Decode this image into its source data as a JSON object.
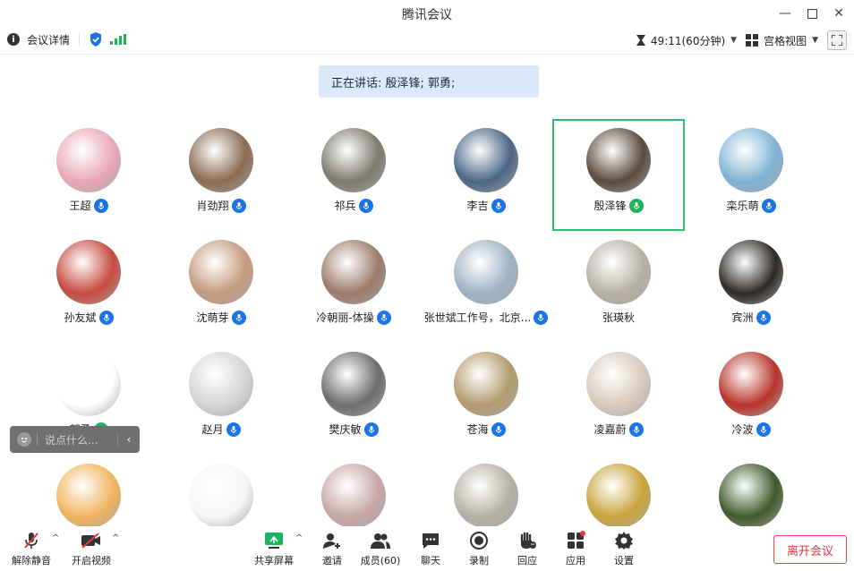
{
  "window": {
    "title": "腾讯会议",
    "controls": [
      "minimize-icon",
      "maximize-icon",
      "close-icon"
    ]
  },
  "infobar": {
    "details_label": "会议详情",
    "timer": "49:11(60分钟)",
    "view_label": "宫格视图"
  },
  "speaking_banner": "正在讲话: 殷泽锋; 郭勇;",
  "participants": [
    {
      "name": "王超",
      "mic": "blue",
      "color": "#e9a8b8"
    },
    {
      "name": "肖劲翔",
      "mic": "blue",
      "color": "#8a6b52"
    },
    {
      "name": "祁兵",
      "mic": "blue",
      "color": "#7d7a6e"
    },
    {
      "name": "李吉",
      "mic": "blue",
      "color": "#4a6684"
    },
    {
      "name": "殷泽锋",
      "mic": "green",
      "color": "#5b4a3f"
    },
    {
      "name": "栾乐萌",
      "mic": "blue",
      "color": "#7fb3d6"
    },
    {
      "name": "孙友斌",
      "mic": "blue",
      "color": "#c64a3f"
    },
    {
      "name": "沈萌芽",
      "mic": "blue",
      "color": "#c59a7e"
    },
    {
      "name": "冷朝丽-体操",
      "mic": "blue",
      "color": "#9c7b6a"
    },
    {
      "name": "张世斌工作号，北京...",
      "mic": "blue",
      "color": "#9fb2c5"
    },
    {
      "name": "张瑛秋",
      "mic": "none",
      "color": "#b7b0a6"
    },
    {
      "name": "宾洲",
      "mic": "blue",
      "color": "#2e2a26"
    },
    {
      "name": "郭勇",
      "mic": "green",
      "color": "#ffffff"
    },
    {
      "name": "赵月",
      "mic": "blue",
      "color": "#d5d5d5"
    },
    {
      "name": "樊庆敏",
      "mic": "blue",
      "color": "#6d6d6d"
    },
    {
      "name": "苍海",
      "mic": "blue",
      "color": "#b39a6e"
    },
    {
      "name": "凌嘉蔚",
      "mic": "blue",
      "color": "#d8c9bd"
    },
    {
      "name": "冷波",
      "mic": "blue",
      "color": "#b8352d"
    },
    {
      "name": "",
      "mic": "none",
      "color": "#f1b45e"
    },
    {
      "name": "",
      "mic": "none",
      "color": "#f5f5f5"
    },
    {
      "name": "",
      "mic": "none",
      "color": "#c8a7a8"
    },
    {
      "name": "",
      "mic": "none",
      "color": "#b6b0a4"
    },
    {
      "name": "",
      "mic": "none",
      "color": "#c9a43c"
    },
    {
      "name": "",
      "mic": "none",
      "color": "#3f5a2b"
    }
  ],
  "chat": {
    "placeholder": "说点什么..."
  },
  "toolbar": {
    "unmute": "解除静音",
    "start_video": "开启视频",
    "share_screen": "共享屏幕",
    "invite": "邀请",
    "members": "成员(60)",
    "chat": "聊天",
    "record": "录制",
    "react": "回应",
    "apps": "应用",
    "settings": "设置",
    "leave": "离开会议"
  },
  "colors": {
    "accent": "#1a73e8",
    "speaking": "#2ec06c",
    "leave": "#e03a3a",
    "banner": "#dbe9fb"
  }
}
